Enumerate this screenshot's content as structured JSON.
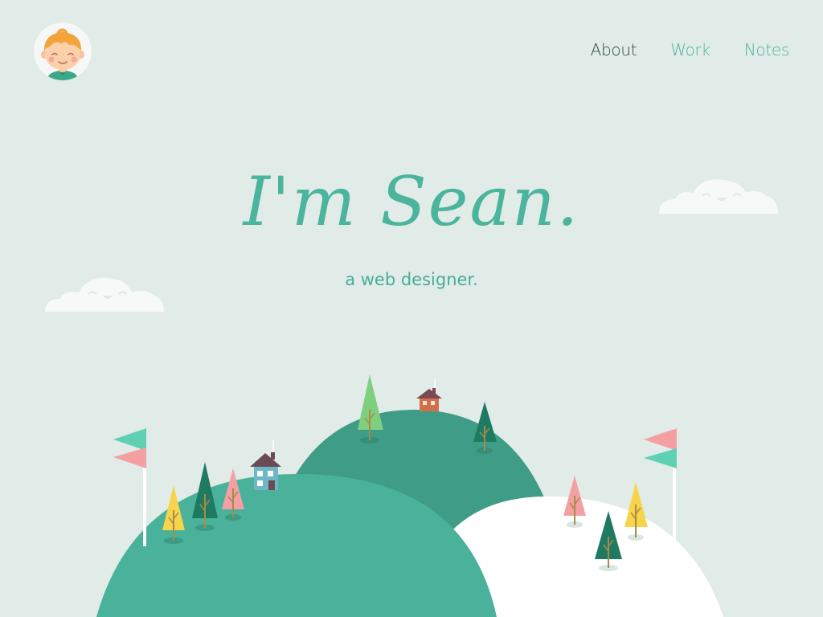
{
  "header": {
    "avatar_icon": "boy-avatar-icon",
    "nav": [
      {
        "label": "About",
        "active": true
      },
      {
        "label": "Work",
        "active": false
      },
      {
        "label": "Notes",
        "active": false
      }
    ]
  },
  "hero": {
    "title": "I'm Sean.",
    "subtitle": "a web designer."
  },
  "colors": {
    "background": "#e1ebe8",
    "accent": "#4bb49d",
    "nav_active": "#2f4b44",
    "hill_dark": "#3f9c86",
    "hill_light": "#4ab29a",
    "hill_white": "#ffffff",
    "flag_pink": "#f4a0a3",
    "flag_teal": "#5fd1b2",
    "tree_yellow": "#f6d54c",
    "tree_pink": "#f4a0a3",
    "tree_green": "#7fd07e",
    "tree_dark": "#1f7a62"
  }
}
